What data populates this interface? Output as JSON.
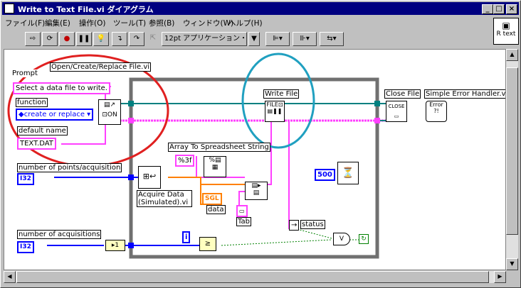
{
  "window": {
    "title": "Write to Text File.vi ダイアグラム",
    "min": "_",
    "max": "□",
    "close": "×"
  },
  "menu": [
    "ファイル(F)",
    "編集(E)",
    "操作(O)",
    "ツール(T)",
    "参照(B)",
    "ウィンドウ(W)",
    "ヘルプ(H)"
  ],
  "toolbar": {
    "font": "12pt アプリケーション・フォント",
    "dropdown": "▼"
  },
  "context_help": {
    "label": "R text"
  },
  "diagram": {
    "prompt_label": "Prompt",
    "prompt_value": "Select a data file to write.",
    "open_vi_label": "Open/Create/Replace File.vi",
    "function_label": "function",
    "function_value": "create or replace",
    "default_name_label": "default name",
    "default_name_value": "TEXT.DAT",
    "points_label": "number of points/acquisition",
    "points_type": "I32",
    "acq_label": "number of acquisitions",
    "acq_type": "I32",
    "const_one": "1",
    "write_file_label": "Write File",
    "close_file_label": "Close File",
    "error_handler_label": "Simple Error Handler.vi",
    "error_icon": "Error ?!",
    "array_to_str_label": "Array To Spreadsheet String",
    "format_value": "%3f",
    "acquire_label": "Acquire Data (Simulated).vi",
    "sgl": "SGL",
    "data_label": "data",
    "tab_label": "Tab",
    "wait_value": "500",
    "status_label": "status",
    "loop_i": "i",
    "close_glyph": "CLOSE"
  },
  "colors": {
    "red_circle": "#e02020",
    "teal_circle": "#20a0c0",
    "pink_wire": "#ff40ff",
    "blue_wire": "#0000ff",
    "orange_wire": "#ff8000",
    "green_wire": "#008000",
    "teal_wire": "#008080"
  }
}
